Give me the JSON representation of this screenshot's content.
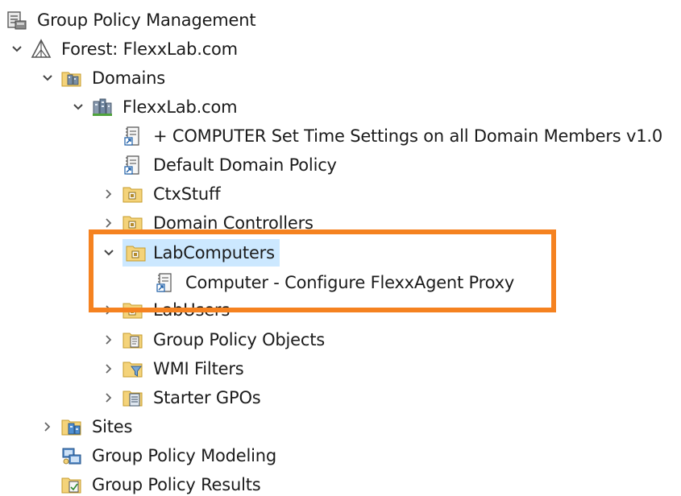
{
  "tree": {
    "root": {
      "label": "Group Policy Management",
      "icon": "gpm-console-icon"
    },
    "forest": {
      "label": "Forest: FlexxLab.com",
      "icon": "forest-icon"
    },
    "domains": {
      "label": "Domains",
      "icon": "domains-folder-icon"
    },
    "domain": {
      "label": "FlexxLab.com",
      "icon": "domain-icon"
    },
    "gpo_link_1": {
      "label": "+ COMPUTER Set Time Settings on all Domain Members v1.0",
      "icon": "gpo-link-icon"
    },
    "gpo_link_2": {
      "label": "Default Domain Policy",
      "icon": "gpo-link-icon"
    },
    "ou_ctxstuff": {
      "label": "CtxStuff",
      "icon": "ou-folder-icon"
    },
    "ou_domain_controllers": {
      "label": "Domain Controllers",
      "icon": "ou-folder-icon"
    },
    "ou_labcomputers": {
      "label": "LabComputers",
      "icon": "ou-folder-icon",
      "selected": true
    },
    "gpo_link_3": {
      "label": "Computer - Configure FlexxAgent Proxy",
      "icon": "gpo-link-icon"
    },
    "ou_labusers": {
      "label": "LabUsers",
      "icon": "ou-folder-icon"
    },
    "gpo_objects": {
      "label": "Group Policy Objects",
      "icon": "gpo-container-icon"
    },
    "wmi_filters": {
      "label": "WMI Filters",
      "icon": "wmi-filter-icon"
    },
    "starter_gpos": {
      "label": "Starter GPOs",
      "icon": "starter-gpo-icon"
    },
    "sites": {
      "label": "Sites",
      "icon": "sites-icon"
    },
    "modeling": {
      "label": "Group Policy Modeling",
      "icon": "gp-modeling-icon"
    },
    "results": {
      "label": "Group Policy Results",
      "icon": "gp-results-icon"
    }
  },
  "highlight_color": "#f58220",
  "selection_color": "#cce8ff"
}
